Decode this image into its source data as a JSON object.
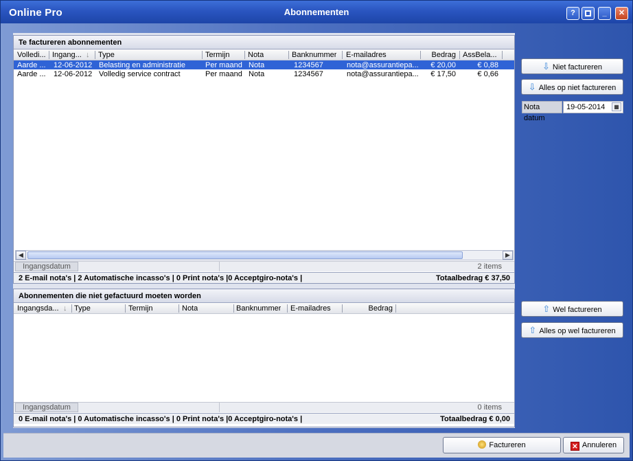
{
  "window": {
    "app_name": "Online Pro",
    "title": "Abonnementen",
    "help": "?",
    "minimize": "_",
    "close": "✕"
  },
  "top_section": {
    "title": "Te factureren abonnementen",
    "columns": [
      "Volledi...",
      "Ingang...",
      "Type",
      "Termijn",
      "Nota",
      "Banknummer",
      "E-mailadres",
      "Bedrag",
      "AssBela..."
    ],
    "rows": [
      [
        "Aarde ...",
        "12-06-2012",
        "Belasting en administratie",
        "Per maand",
        "Nota",
        "1234567",
        "nota@assurantiepa...",
        "€ 20,00",
        "€ 0,88"
      ],
      [
        "Aarde ...",
        "12-06-2012",
        "Volledig service contract",
        "Per maand",
        "Nota",
        "1234567",
        "nota@assurantiepa...",
        "€ 17,50",
        "€ 0,66"
      ]
    ],
    "group_tab": "Ingangsdatum",
    "item_count": "2 items",
    "summary_left": "2 E-mail nota's | 2 Automatische incasso's | 0 Print nota's |0 Acceptgiro-nota's |",
    "summary_right": "Totaalbedrag € 37,50"
  },
  "bottom_section": {
    "title": "Abonnementen die niet gefactuurd moeten worden",
    "columns": [
      "Ingangsda...",
      "Type",
      "Termijn",
      "Nota",
      "Banknummer",
      "E-mailadres",
      "Bedrag"
    ],
    "group_tab": "Ingangsdatum",
    "item_count": "0 items",
    "summary_left": "0 E-mail nota's | 0 Automatische incasso's | 0 Print nota's |0 Acceptgiro-nota's |",
    "summary_right": "Totaalbedrag € 0,00"
  },
  "side": {
    "niet_factureren": "Niet factureren",
    "alles_niet": "Alles op niet factureren",
    "nota_datum_label": "Nota datum",
    "nota_datum_value": "19-05-2014",
    "wel_factureren": "Wel factureren",
    "alles_wel": "Alles op wel factureren"
  },
  "footer": {
    "factureren": "Factureren",
    "annuleren": "Annuleren"
  },
  "colors": {
    "selection": "#2f63d6",
    "title_bar": "#2a55c0"
  }
}
